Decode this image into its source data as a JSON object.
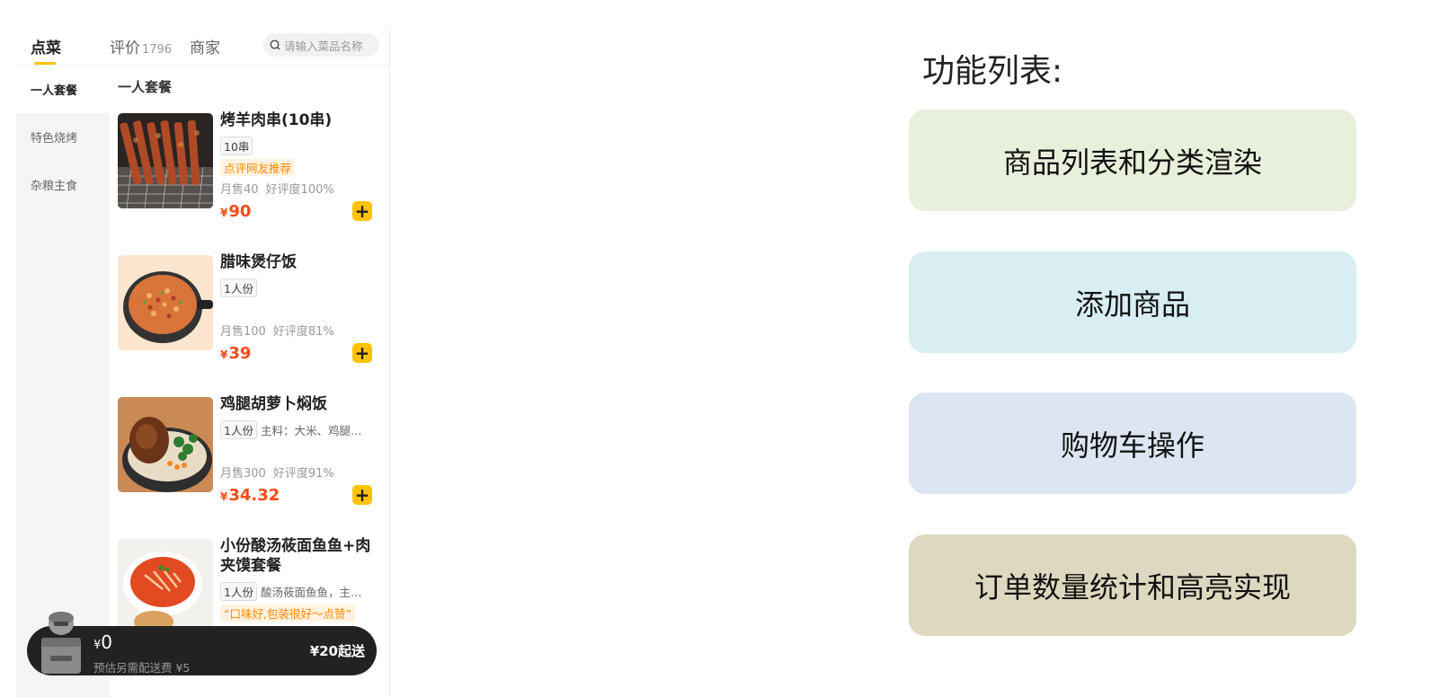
{
  "tabs": [
    {
      "label": "点菜",
      "count": ""
    },
    {
      "label": "评价",
      "count": "1796"
    },
    {
      "label": "商家",
      "count": ""
    }
  ],
  "search": {
    "placeholder": "请输入菜品名称"
  },
  "sidebar": {
    "items": [
      {
        "label": "一人套餐",
        "active": true
      },
      {
        "label": "特色烧烤",
        "active": false
      },
      {
        "label": "杂粮主食",
        "active": false
      }
    ]
  },
  "section_title": "一人套餐",
  "products": [
    {
      "name": "烤羊肉串(10串)",
      "tag": "10串",
      "desc": "",
      "reco": "点评网友推荐",
      "sales": "月售40",
      "rating": "好评度100%",
      "currency": "¥",
      "price": "90",
      "add": "+"
    },
    {
      "name": "腊味煲仔饭",
      "tag": "1人份",
      "desc": "",
      "reco": "",
      "sales": "月售100",
      "rating": "好评度81%",
      "currency": "¥",
      "price": "39",
      "add": "+"
    },
    {
      "name": "鸡腿胡萝卜焖饭",
      "tag": "1人份",
      "desc": "主料：大米、鸡腿…",
      "reco": "",
      "sales": "月售300",
      "rating": "好评度91%",
      "currency": "¥",
      "price": "34.32",
      "add": "+"
    },
    {
      "name": "小份酸汤莜面鱼鱼+肉夹馍套餐",
      "tag": "1人份",
      "desc": "酸汤莜面鱼鱼，主…",
      "reco": "“口味好,包装很好～点赞”",
      "sales": "",
      "rating": "",
      "currency": "",
      "price": "",
      "add": ""
    }
  ],
  "cart": {
    "currency": "¥",
    "total": "0",
    "fee": "预估另需配送费 ¥5",
    "min_order": "¥20起送"
  },
  "panel": {
    "title": "功能列表:",
    "cards": [
      {
        "label": "商品列表和分类渲染",
        "color": "#e8f0dc"
      },
      {
        "label": "添加商品",
        "color": "#d8eef3"
      },
      {
        "label": "购物车操作",
        "color": "#dbe6f2"
      },
      {
        "label": "订单数量统计和高亮实现",
        "color": "#ddd8bf"
      }
    ]
  },
  "colors": {
    "accent": "#ffc300",
    "price": "#ff4a16",
    "cart_bg": "#222222"
  }
}
